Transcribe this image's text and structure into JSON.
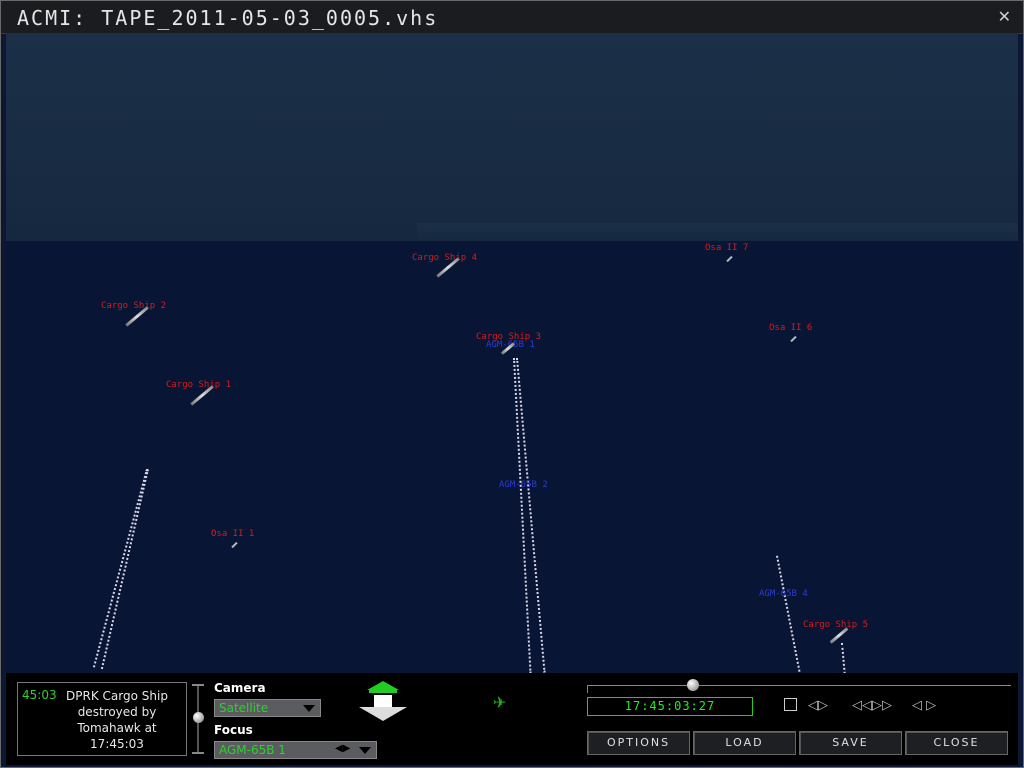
{
  "window": {
    "title": "ACMI:  TAPE_2011-05-03_0005.vhs",
    "close_icon": "close-icon"
  },
  "units": {
    "cargo_ship_1": "Cargo Ship 1",
    "cargo_ship_2": "Cargo Ship 2",
    "cargo_ship_3": "Cargo Ship 3",
    "cargo_ship_4": "Cargo Ship 4",
    "cargo_ship_5": "Cargo Ship 5",
    "osa_1": "Osa II 1",
    "osa_6": "Osa II 6",
    "osa_7": "Osa II 7",
    "missile_top": "AGM-65B 1",
    "missile_mid": "AGM-65B 2",
    "missile_right": "AGM-65B 4"
  },
  "message": {
    "time": "45:03",
    "text": "DPRK Cargo Ship destroyed by Tomahawk at 17:45:03"
  },
  "camera": {
    "label": "Camera",
    "value": "Satellite"
  },
  "focus": {
    "label": "Focus",
    "value": "AGM-65B 1"
  },
  "timeline": {
    "time": "17:45:03:27",
    "progress": 0.25
  },
  "buttons": {
    "options": "OPTIONS",
    "load": "LOAD",
    "save": "SAVE",
    "close": "CLOSE"
  },
  "colors": {
    "hostile": "#d31d1d",
    "friendly": "#2c3cd6",
    "hud_green": "#22cc22"
  }
}
